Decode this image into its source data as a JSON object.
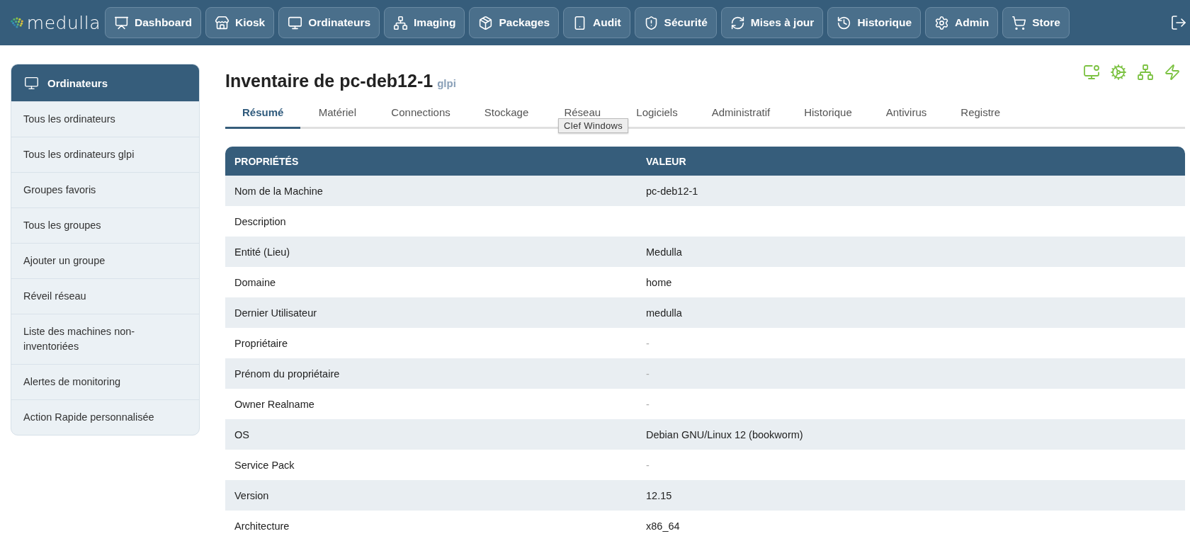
{
  "brand": "medulla",
  "nav": [
    {
      "label": "Dashboard",
      "selected": false
    },
    {
      "label": "Kiosk",
      "selected": false
    },
    {
      "label": "Ordinateurs",
      "selected": false
    },
    {
      "label": "Imaging",
      "selected": false
    },
    {
      "label": "Packages",
      "selected": false
    },
    {
      "label": "Audit",
      "selected": false
    },
    {
      "label": "Sécurité",
      "selected": false
    },
    {
      "label": "Mises à jour",
      "selected": false
    },
    {
      "label": "Historique",
      "selected": false
    },
    {
      "label": "Admin",
      "selected": false
    },
    {
      "label": "Store",
      "selected": false
    }
  ],
  "sidebar": {
    "title": "Ordinateurs",
    "items": [
      {
        "label": "Tous les ordinateurs"
      },
      {
        "label": "Tous les ordinateurs glpi"
      },
      {
        "label": "Groupes favoris"
      },
      {
        "label": "Tous les groupes"
      },
      {
        "label": "Ajouter un groupe"
      },
      {
        "label": "Réveil réseau"
      },
      {
        "label": "Liste des machines non-inventoriées"
      },
      {
        "label": "Alertes de monitoring"
      },
      {
        "label": "Action Rapide personnalisée"
      }
    ]
  },
  "page": {
    "title": "Inventaire de pc-deb12-1",
    "source": "glpi"
  },
  "tabs": [
    {
      "label": "Résumé",
      "selected": true
    },
    {
      "label": "Matériel",
      "selected": false
    },
    {
      "label": "Connections",
      "selected": false
    },
    {
      "label": "Stockage",
      "selected": false
    },
    {
      "label": "Réseau",
      "selected": false
    },
    {
      "label": "Logiciels",
      "selected": false
    },
    {
      "label": "Administratif",
      "selected": false
    },
    {
      "label": "Historique",
      "selected": false
    },
    {
      "label": "Antivirus",
      "selected": false
    },
    {
      "label": "Registre",
      "selected": false
    }
  ],
  "tooltip": "Clef Windows",
  "table": {
    "columns": [
      "PROPRIÉTÉS",
      "VALEUR"
    ],
    "rows": [
      {
        "property": "Nom de la Machine",
        "value": "pc-deb12-1"
      },
      {
        "property": "Description"
      },
      {
        "property": "Entité (Lieu)",
        "value": "Medulla"
      },
      {
        "property": "Domaine",
        "value": "home"
      },
      {
        "property": "Dernier Utilisateur",
        "value": "medulla"
      },
      {
        "property": "Propriétaire",
        "value": "-",
        "muted": true
      },
      {
        "property": "Prénom du propriétaire",
        "value": "-",
        "muted": true
      },
      {
        "property": "Owner Realname",
        "value": "-",
        "muted": true
      },
      {
        "property": "OS",
        "value": "Debian GNU/Linux 12 (bookworm)"
      },
      {
        "property": "Service Pack",
        "value": "-",
        "muted": true
      },
      {
        "property": "Version",
        "value": "12.15"
      },
      {
        "property": "Architecture",
        "value": "x86_64"
      }
    ]
  }
}
